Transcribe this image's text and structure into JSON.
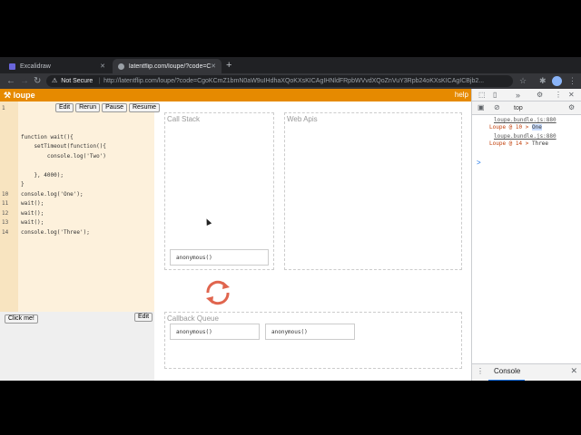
{
  "browser": {
    "tabs": [
      {
        "title": "Excalidraw",
        "active": false
      },
      {
        "title": "latentflip.com/loupe/?code=Cg...",
        "active": true
      }
    ],
    "new_tab": "+",
    "security_label": "Not Secure",
    "url": "http://latentflip.com/loupe/?code=CgoKCmZ1bmN0aW9uIHdhaXQoKXsKICAgIHNldFRpbWVvdXQoZnVuY3Rpb24oKXsKICAgICBjb2...",
    "colors": {
      "frame": "#202124",
      "toolbar": "#35363a"
    }
  },
  "loupe": {
    "logo": "loupe",
    "help": "help",
    "editor_buttons": {
      "edit": "Edit",
      "rerun": "Rerun",
      "pause": "Pause",
      "resume": "Resume"
    },
    "code_lines": [
      "",
      "",
      "",
      "",
      "function wait(){",
      "    setTimeout(function(){",
      "        console.log('Two')",
      "",
      "    }, 4000);",
      "}",
      "console.log('One');",
      "wait();",
      "wait();",
      "wait();",
      "console.log('Three');"
    ],
    "line_numbers": [
      "1",
      "",
      "",
      "",
      "",
      "",
      "",
      "",
      "",
      "10",
      "11",
      "12",
      "13",
      "14",
      ""
    ],
    "html_pane": {
      "button": "Click me!",
      "edit": "Edit"
    },
    "call_stack": {
      "label": "Call Stack",
      "frames": [
        "anonymous()"
      ]
    },
    "web_apis": {
      "label": "Web Apis"
    },
    "callback_queue": {
      "label": "Callback Queue",
      "items": [
        "anonymous()",
        "anonymous()"
      ]
    },
    "accent_color": "#e68a00"
  },
  "devtools": {
    "context": "top",
    "logs": [
      {
        "source": "loupe.bundle.js:880",
        "prefix": "Loupe @ 10 > ",
        "value": "One",
        "highlight": true
      },
      {
        "source": "loupe.bundle.js:880",
        "prefix": "Loupe @ 14 > ",
        "value": "Three",
        "highlight": false
      }
    ],
    "prompt": ">",
    "drawer_title": "Console"
  }
}
